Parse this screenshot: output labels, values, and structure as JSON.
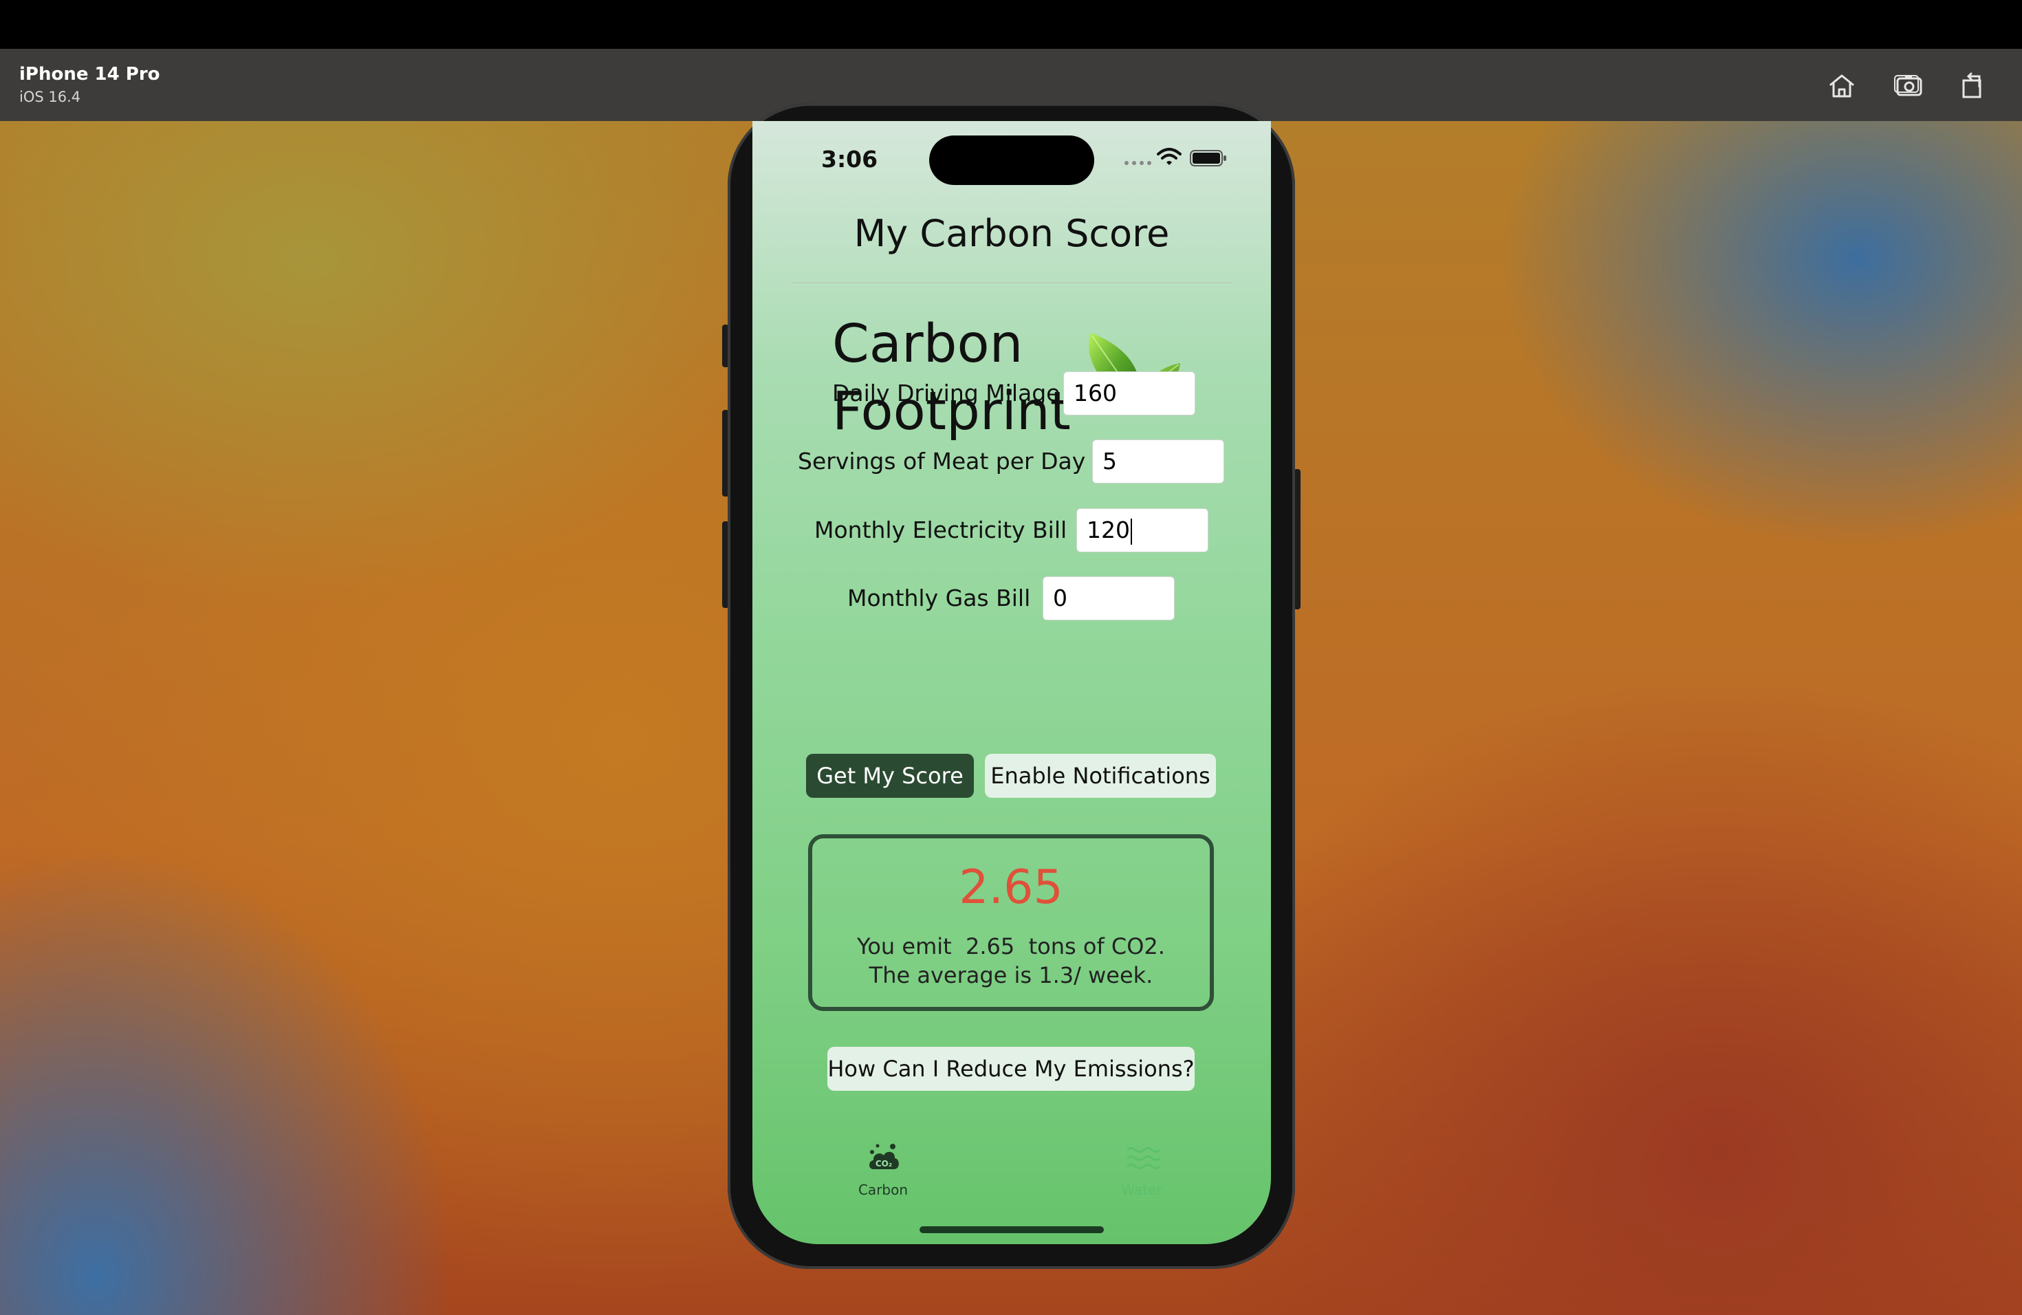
{
  "simulator": {
    "device_name": "iPhone 14 Pro",
    "os_version": "iOS 16.4",
    "toolbar_icons": [
      "home-icon",
      "screenshot-icon",
      "rotate-icon"
    ]
  },
  "status_bar": {
    "time": "3:06"
  },
  "app": {
    "nav_title": "My Carbon Score",
    "heading_line1": "Carbon",
    "heading_line2": "Footprint",
    "fields": [
      {
        "label": "Daily Driving Milage",
        "value": "160"
      },
      {
        "label": "Servings of Meat per Day",
        "value": "5"
      },
      {
        "label": "Monthly Electricity Bill",
        "value": "120"
      },
      {
        "label": "Monthly Gas Bill",
        "value": "0"
      }
    ],
    "buttons": {
      "get_score": "Get My Score",
      "enable_notifications": "Enable Notifications",
      "reduce": "How Can I Reduce My Emissions?"
    },
    "result": {
      "score": "2.65",
      "line1": "You emit  2.65  tons of CO2.",
      "line2": "The average is 1.3/ week."
    },
    "tabs": [
      {
        "label": "Carbon",
        "icon": "co2-cloud-icon",
        "selected": true
      },
      {
        "label": "Water",
        "icon": "water-waves-icon",
        "selected": false
      }
    ]
  },
  "colors": {
    "score_text": "#e0503a",
    "primary_button": "#2b4a32",
    "tab_selected": "#1f3a24",
    "tab_unselected": "#5cc06a"
  }
}
